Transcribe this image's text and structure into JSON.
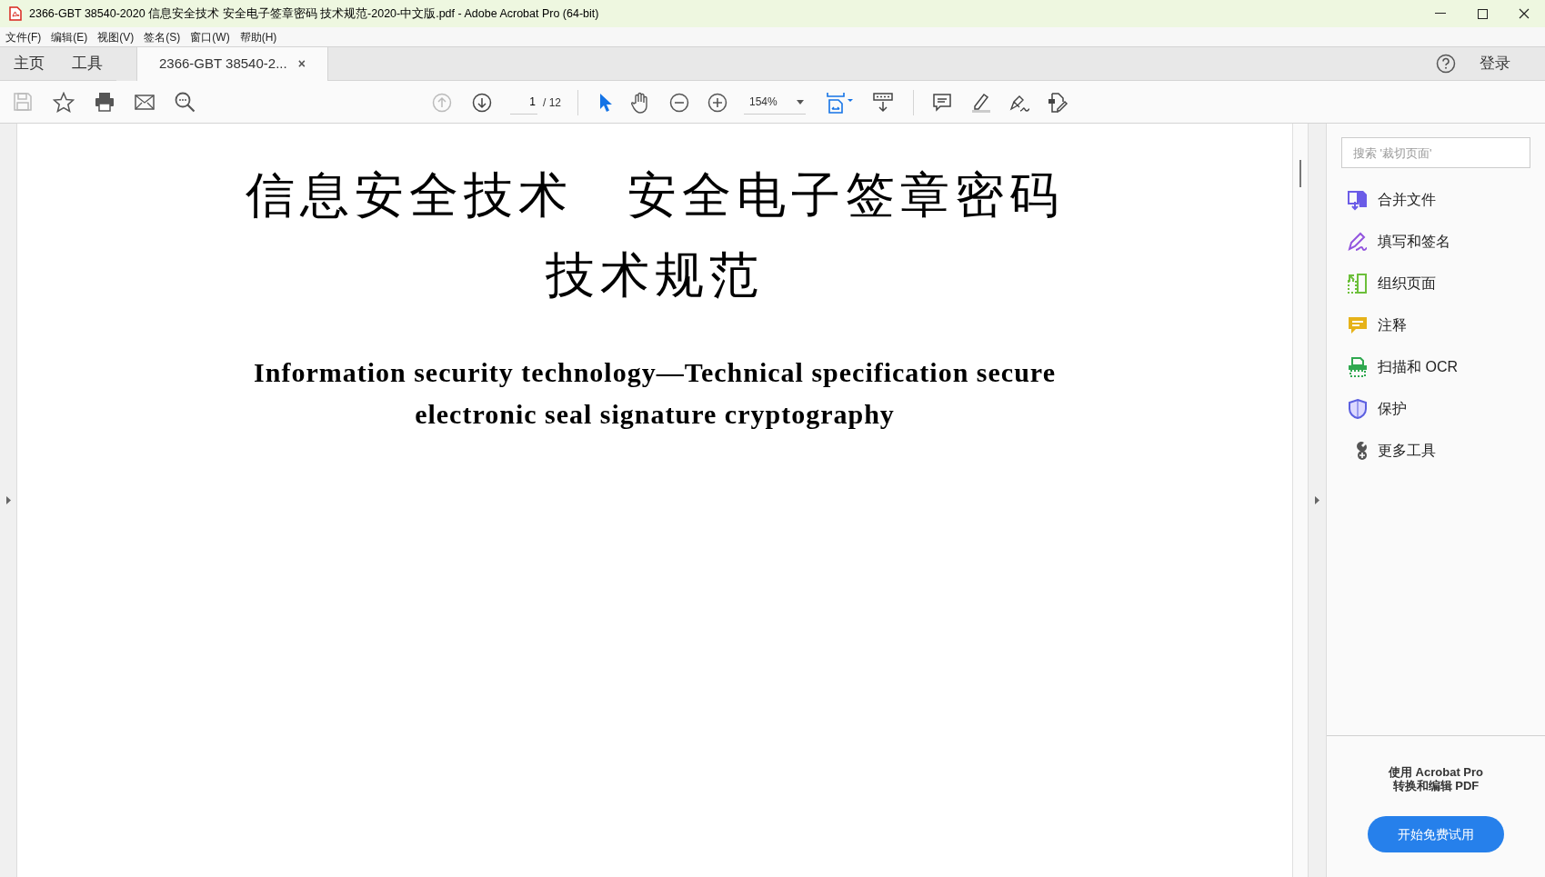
{
  "window": {
    "title": "2366-GBT 38540-2020 信息安全技术 安全电子签章密码 技术规范-2020-中文版.pdf - Adobe Acrobat Pro (64-bit)"
  },
  "menu": [
    "文件(F)",
    "编辑(E)",
    "视图(V)",
    "签名(S)",
    "窗口(W)",
    "帮助(H)"
  ],
  "tabs": [
    {
      "label": "主页",
      "selected": false
    },
    {
      "label": "工具",
      "selected": false
    },
    {
      "label": "2366-GBT 38540-2...",
      "selected": true,
      "close": "×"
    }
  ],
  "login": "登录",
  "toolbar": {
    "page": "1",
    "page_count": "/ 12",
    "zoom": "154%"
  },
  "document": {
    "title_lines": [
      "信息安全技术　安全电子签章密码",
      "技术规范"
    ],
    "subtitle_lines": [
      "Information security technology—Technical specification secure",
      "electronic seal signature cryptography"
    ]
  },
  "tools_panel": {
    "search": {
      "placeholder": "搜索 '裁切页面'"
    },
    "items": [
      {
        "kind": "combine",
        "label": "合并文件"
      },
      {
        "kind": "sign",
        "label": "填写和签名"
      },
      {
        "kind": "organize",
        "label": "组织页面"
      },
      {
        "kind": "comment",
        "label": "注释"
      },
      {
        "kind": "scan",
        "label": "扫描和 OCR"
      },
      {
        "kind": "protect",
        "label": "保护"
      },
      {
        "kind": "more",
        "label": "更多工具"
      }
    ],
    "promo": {
      "lines": [
        "使用 Acrobat Pro",
        "转换和编辑 PDF"
      ],
      "button": "开始免费试用"
    }
  }
}
